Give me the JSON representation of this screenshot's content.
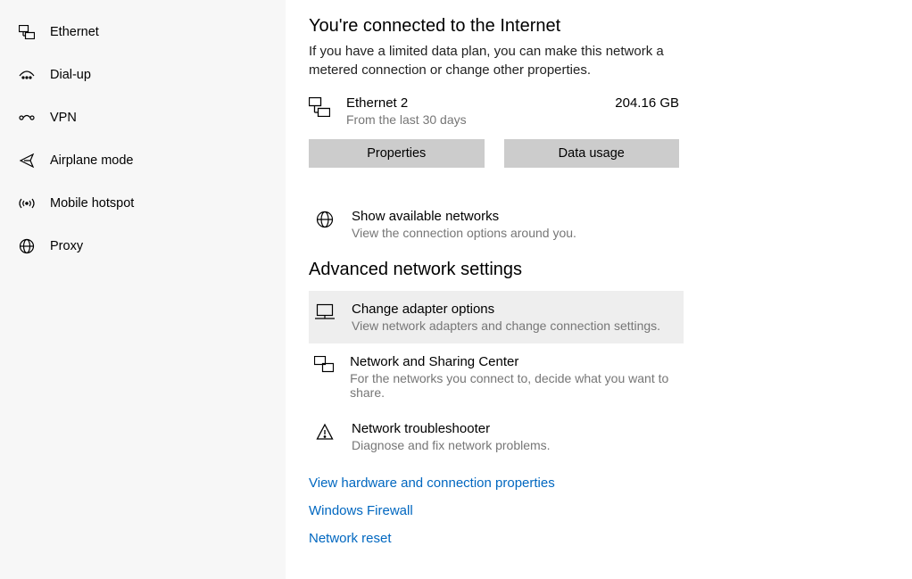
{
  "sidebar": {
    "items": [
      {
        "label": "Ethernet"
      },
      {
        "label": "Dial-up"
      },
      {
        "label": "VPN"
      },
      {
        "label": "Airplane mode"
      },
      {
        "label": "Mobile hotspot"
      },
      {
        "label": "Proxy"
      }
    ]
  },
  "main": {
    "heading": "You're connected to the Internet",
    "sub": "If you have a limited data plan, you can make this network a metered connection or change other properties.",
    "connection": {
      "name": "Ethernet 2",
      "subtitle": "From the last 30 days",
      "usage": "204.16 GB"
    },
    "buttons": {
      "properties": "Properties",
      "usage": "Data usage"
    },
    "available": {
      "title": "Show available networks",
      "sub": "View the connection options around you."
    },
    "advanced_heading": "Advanced network settings",
    "adapter": {
      "title": "Change adapter options",
      "sub": "View network adapters and change connection settings."
    },
    "sharing": {
      "title": "Network and Sharing Center",
      "sub": "For the networks you connect to, decide what you want to share."
    },
    "troubleshoot": {
      "title": "Network troubleshooter",
      "sub": "Diagnose and fix network problems."
    },
    "links": {
      "hardware": "View hardware and connection properties",
      "firewall": "Windows Firewall",
      "reset": "Network reset"
    }
  }
}
